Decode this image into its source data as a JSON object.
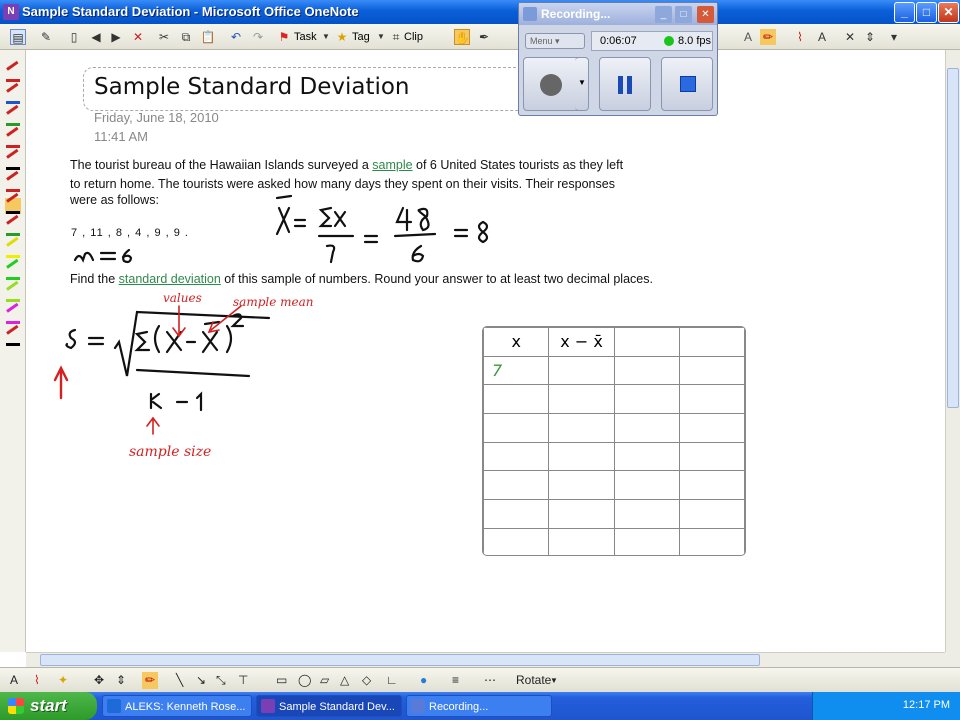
{
  "window": {
    "title": "Sample Standard Deviation - Microsoft Office OneNote",
    "buttons": [
      "_",
      "□",
      "✕"
    ]
  },
  "toolbar": {
    "task_label": "Task",
    "tag_label": "Tag",
    "clip_label": "Clip"
  },
  "recording": {
    "title": "Recording...",
    "menu_label": "Menu",
    "elapsed": "0:06:07",
    "fps": "8.0 fps"
  },
  "page": {
    "title": "Sample Standard Deviation",
    "date": "Friday, June 18, 2010",
    "time": "11:41 AM",
    "intro_1": "The tourist bureau of the Hawaiian Islands surveyed a ",
    "intro_link": "sample",
    "intro_2": " of 6 United States tourists as they left",
    "intro_line2": "to return home. The tourists were asked how many days they spent on their visits. Their responses",
    "intro_line3": "were as follows:",
    "data_values": "7 , 11 , 8 , 4 , 9 , 9 .",
    "question_1": "Find the ",
    "question_link": "standard deviation",
    "question_2": " of this sample of numbers. Round your answer to at least two decimal places."
  },
  "handwriting": {
    "n_eq": "n = 6",
    "mean_formula": "x̄ = Σx / n = 48 / 6 = 8",
    "s_formula": "s = √( Σ(x − x̄)² / (n − 1) )",
    "annot_values": "values",
    "annot_sample_mean": "sample mean",
    "annot_sample_size": "sample size"
  },
  "grid": {
    "headers": [
      "x",
      "x − x̄",
      "",
      ""
    ],
    "first_value": "7"
  },
  "drawbar": {
    "rotate_label": "Rotate"
  },
  "taskbar": {
    "start_label": "start",
    "tasks": [
      "ALEKS: Kenneth Rose...",
      "Sample Standard Dev...",
      "Recording..."
    ],
    "clock": "12:17 PM"
  },
  "colors": {
    "handwriting_black": "#111111",
    "annotation_red": "#d42020",
    "link_green": "#2e8a4a",
    "table_green": "#3a9a3a"
  }
}
